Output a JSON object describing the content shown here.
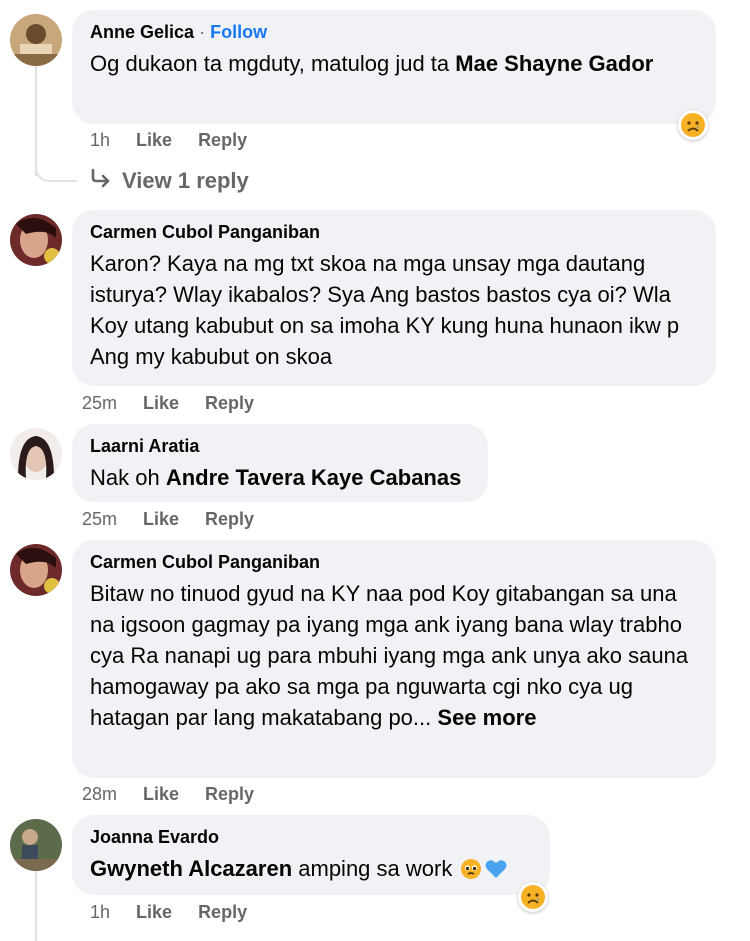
{
  "comments": [
    {
      "author": "Anne Gelica",
      "follow_sep": "·",
      "follow_label": "Follow",
      "text_pre": "Og dukaon ta mgduty, matulog jud ta ",
      "mention": "Mae Shayne Gador",
      "time": "1h",
      "like": "Like",
      "reply": "Reply",
      "reaction": "sad-face"
    },
    {
      "author": "Carmen Cubol Panganiban",
      "text": "Karon? Kaya na mg txt skoa na mga unsay mga dautang isturya? Wlay ikabalos? Sya Ang bastos bastos cya oi? Wla Koy utang kabubut on sa imoha KY kung huna hunaon ikw p Ang my kabubut on skoa",
      "time": "25m",
      "like": "Like",
      "reply": "Reply"
    },
    {
      "author": "Laarni Aratia",
      "text_pre": "Nak oh ",
      "mention": "Andre Tavera Kaye Cabanas",
      "time": "25m",
      "like": "Like",
      "reply": "Reply"
    },
    {
      "author": "Carmen Cubol Panganiban",
      "text": "Bitaw no tinuod gyud na KY naa pod Koy gitabangan sa una na igsoon gagmay pa iyang mga ank iyang bana wlay trabho cya Ra nanapi ug para mbuhi iyang mga ank unya ako sauna hamogaway pa ako sa mga pa nguwarta cgi nko cya ug hatagan par lang makatabang po...",
      "see_more": "See more",
      "time": "28m",
      "like": "Like",
      "reply": "Reply"
    },
    {
      "author": "Joanna Evardo",
      "mention": "Gwyneth Alcazaren",
      "text_post": " amping sa work ",
      "time": "1h",
      "like": "Like",
      "reply": "Reply",
      "reaction": "sad-face"
    }
  ],
  "view_reply": {
    "label": "View 1 reply",
    "icon": "reply-arrow-icon"
  },
  "colors": {
    "bubble": "#f0f2f5",
    "meta": "#65676b",
    "link": "#1877f2",
    "reaction_face": "#f7b125"
  }
}
